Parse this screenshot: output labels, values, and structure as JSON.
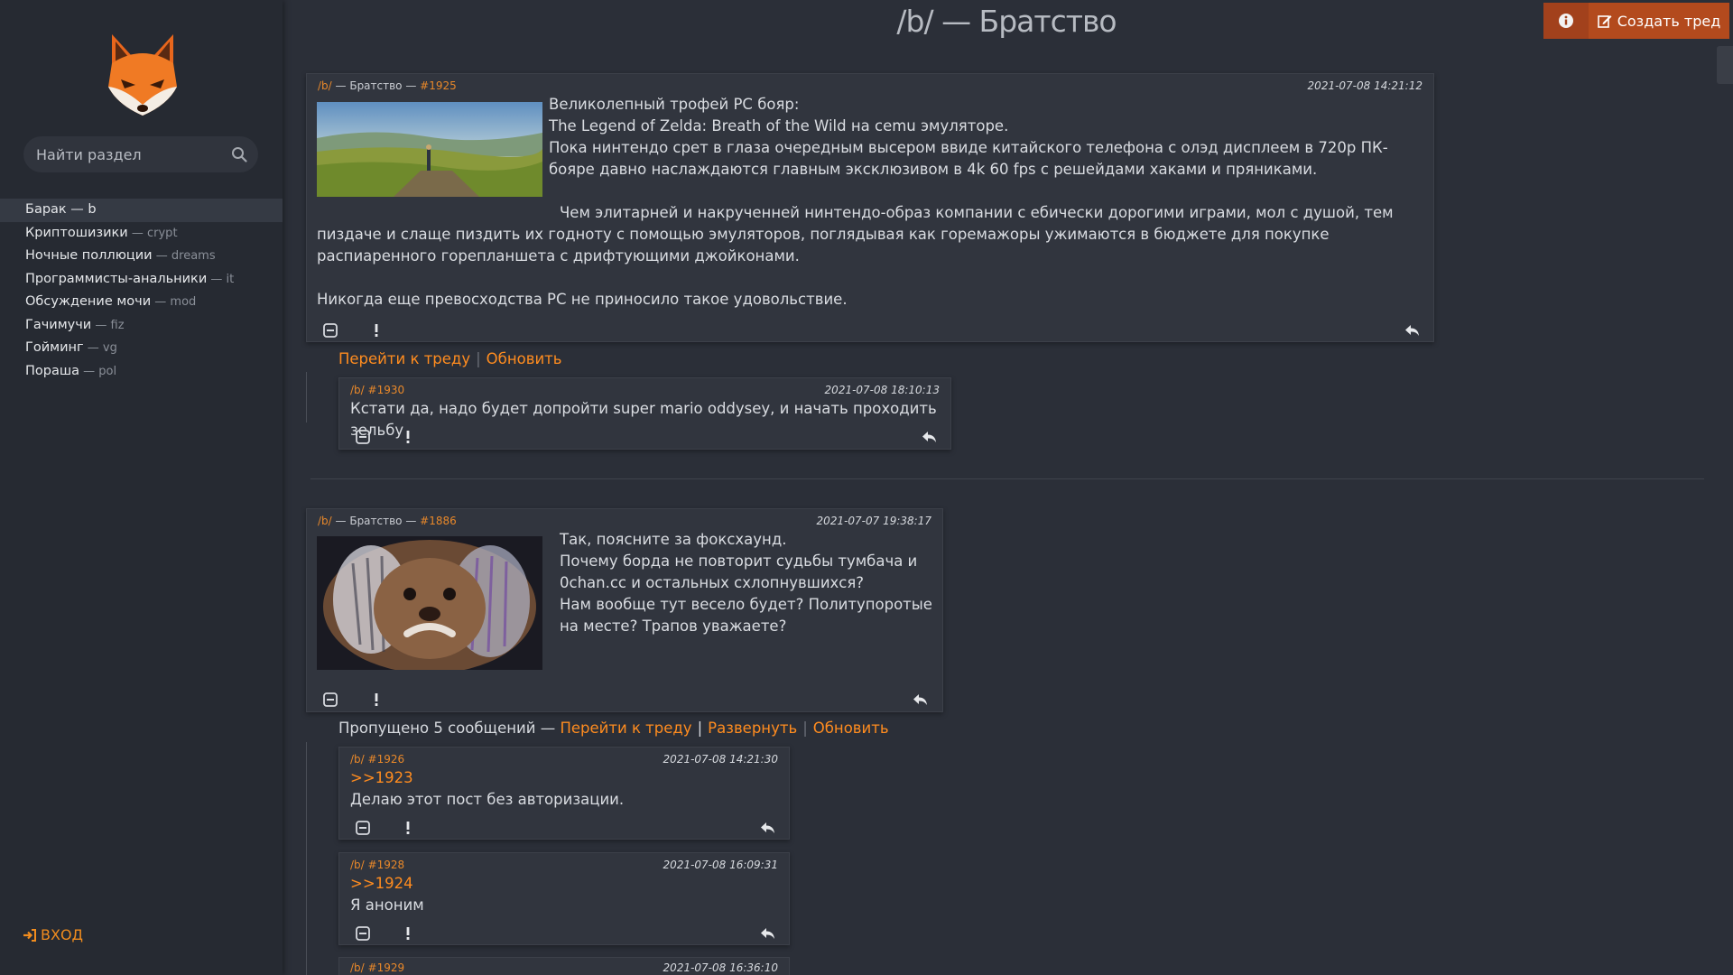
{
  "header": {
    "title": "/b/ — Братство",
    "create_label": "Создать тред"
  },
  "sidebar": {
    "search_placeholder": "Найти раздел",
    "boards": [
      {
        "name": "Барак",
        "sep": " — ",
        "code": "b",
        "active": true
      },
      {
        "name": "Криптошизики",
        "sep": " — ",
        "code": "crypt"
      },
      {
        "name": "Ночные поллюции",
        "sep": " — ",
        "code": "dreams"
      },
      {
        "name": "Программисты-анальники",
        "sep": " — ",
        "code": "it"
      },
      {
        "name": "Обсуждение мочи",
        "sep": " — ",
        "code": "mod"
      },
      {
        "name": "Гачимучи",
        "sep": " — ",
        "code": "fiz"
      },
      {
        "name": "Гойминг",
        "sep": " — ",
        "code": "vg"
      },
      {
        "name": "Пораша",
        "sep": " — ",
        "code": "pol"
      }
    ],
    "login_label": "ВХОД"
  },
  "threads": [
    {
      "op": {
        "board": "/b/",
        "board_name": " — Братство — ",
        "num": "#1925",
        "date": "2021-07-08 14:21:12",
        "paragraphs": [
          "Великолепный трофей PC бояр:",
          "The Legend of Zelda: Breath of the Wild на cemu эмуляторе.",
          "Пока нинтендо срет в глаза очередным высером ввиде китайского телефона с олэд дисплеем в 720р ПК-бояре давно наслаждаются главным эксклюзивом в 4k 60 fps с решейдами хаками и пряниками.",
          "",
          "Чем элитарней и накрученней нинтендо-образ компании с ебически дорогими играми, мол с душой, тем пиздаче и слаще пиздить их годноту с помощью эмуляторов, поглядывая как горемажоры ужимаются в бюджете для покупке распиаренного горепланшета с дрифтующими джойконами.",
          "",
          "Никогда еще превосходства PC не приносило такое удовольствие."
        ]
      },
      "links": {
        "goto": "Перейти к треду",
        "refresh": "Обновить"
      },
      "replies": [
        {
          "board": "/b/",
          "num": "#1930",
          "date": "2021-07-08 18:10:13",
          "text": "Кстати да, надо будет допройти super mario oddysey, и начать проходить зельбу"
        }
      ]
    },
    {
      "op": {
        "board": "/b/",
        "board_name": " — Братство — ",
        "num": "#1886",
        "date": "2021-07-07 19:38:17",
        "paragraphs": [
          "Так, поясните за фоксхаунд.",
          "Почему борда не повторит судьбы тумбача и 0chan.cc и остальных схлопнувшихся?",
          "Нам вообще тут весело будет? Политупоротые на месте? Трапов уважаете?"
        ]
      },
      "links": {
        "skipped": "Пропущено 5 сообщений — ",
        "goto": "Перейти к треду",
        "expand": "Развернуть",
        "refresh": "Обновить"
      },
      "replies": [
        {
          "board": "/b/",
          "num": "#1926",
          "date": "2021-07-08 14:21:30",
          "ref": ">>1923",
          "text": "Делаю этот пост без авторизации."
        },
        {
          "board": "/b/",
          "num": "#1928",
          "date": "2021-07-08 16:09:31",
          "ref": ">>1924",
          "text": "Я аноним"
        },
        {
          "board": "/b/",
          "num": "#1929",
          "date": "2021-07-08 16:36:10"
        }
      ]
    }
  ]
}
